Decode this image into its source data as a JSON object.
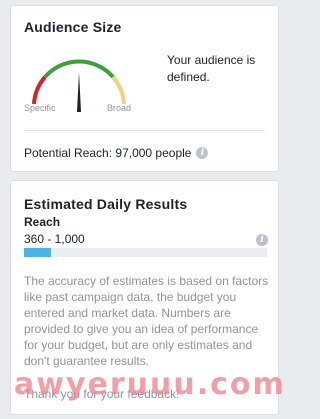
{
  "audience_size": {
    "title": "Audience Size",
    "status": "Your audience is defined.",
    "gauge": {
      "specific_label": "Specific",
      "broad_label": "Broad",
      "colors": {
        "specific": "#d0262d",
        "defined": "#3aa13a",
        "broad": "#e8d57d",
        "needle": "#1d2129"
      }
    },
    "potential_reach": "Potential Reach: 97,000 people",
    "info_icon": "info-icon"
  },
  "daily_results": {
    "title": "Estimated Daily Results",
    "metric_label": "Reach",
    "range": "360 - 1,000",
    "bar_fill_fraction": 0.11,
    "bar_color": "#4cb5e6",
    "info_icon": "info-icon",
    "disclaimer": "The accuracy of estimates is based on factors like past campaign data, the budget you entered and market data. Numbers are provided to give you an idea of performance for your budget, but are only estimates and don't guarantee results.",
    "feedback": "Thank you for your feedback!"
  },
  "watermark": "awyeruuu.com"
}
